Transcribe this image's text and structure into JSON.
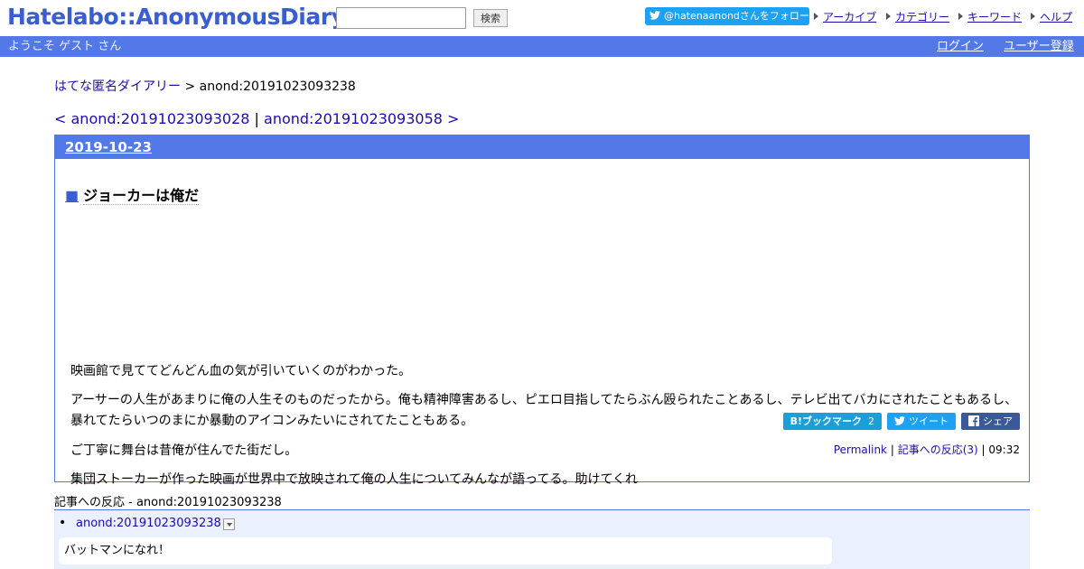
{
  "header": {
    "logo": "Hatelabo::AnonymousDiary",
    "search": {
      "value": "",
      "placeholder": "",
      "button_label": "検索"
    },
    "follow_button": "@hatenaanondさんをフォロー",
    "links": [
      "アーカイブ",
      "カテゴリー",
      "キーワード",
      "ヘルプ"
    ]
  },
  "bar": {
    "welcome": "ようこそ ゲスト さん",
    "login": "ログイン",
    "register": "ユーザー登録"
  },
  "breadcrumb": {
    "home": "はてな匿名ダイアリー",
    "separator": ">",
    "current": "anond:20191023093238"
  },
  "pager": {
    "prev": "< anond:20191023093028",
    "separator": "|",
    "next": "anond:20191023093058 >"
  },
  "article": {
    "date": "2019-10-23",
    "title_marker": "■",
    "title": "ジョーカーは俺だ",
    "paragraphs": [
      "映画館で見ててどんどん血の気が引いていくのがわかった。",
      "アーサーの人生があまりに俺の人生そのものだったから。俺も精神障害あるし、ピエロ目指してたらぶん殴られたことあるし、テレビ出てバカにされたこともあるし、暴れてたらいつのまにか暴動のアイコンみたいにされてたこともある。",
      "ご丁寧に舞台は昔俺が住んでた街だし。",
      "集団ストーカーが作った映画が世界中で放映されて俺の人生についてみんなが語ってる。助けてくれ"
    ],
    "share": {
      "hatebu_label": "B!ブックマーク",
      "hatebu_count": "2",
      "tweet_label": "ツイート",
      "fb_label": "シェア"
    },
    "footer": {
      "permalink": "Permalink",
      "separator": "|",
      "reactions": "記事への反応(3)",
      "time": "09:32"
    }
  },
  "reactions": {
    "title": "記事への反応 - anond:20191023093238",
    "items": [
      {
        "link": "anond:20191023093238",
        "text": "バットマンになれ！"
      }
    ]
  },
  "colors": {
    "brand": "#3a5ed0",
    "bar": "#5279e7",
    "twitter": "#1da1f2",
    "hatebu": "#1b9fd8",
    "facebook": "#3b5998",
    "reaction_bg": "#eaf0fe"
  }
}
